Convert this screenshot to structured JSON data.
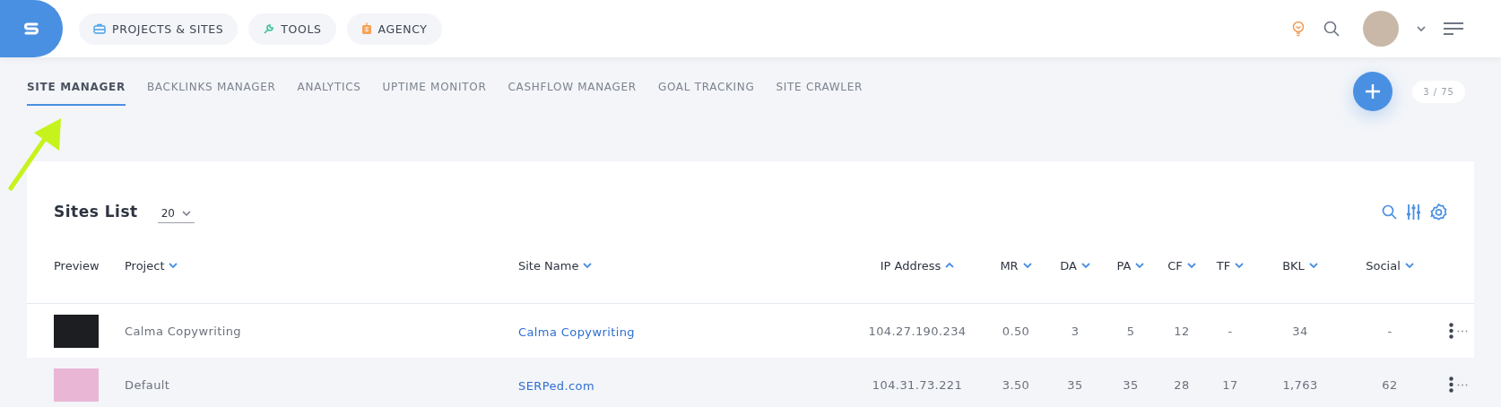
{
  "nav_buttons": [
    {
      "label": "PROJECTS & SITES",
      "kind": "briefcase"
    },
    {
      "label": "TOOLS",
      "kind": "wrench"
    },
    {
      "label": "AGENCY",
      "kind": "building"
    }
  ],
  "tabs": [
    {
      "label": "SITE MANAGER",
      "selected": true
    },
    {
      "label": "BACKLINKS MANAGER",
      "selected": false
    },
    {
      "label": "ANALYTICS",
      "selected": false
    },
    {
      "label": "UPTIME MONITOR",
      "selected": false
    },
    {
      "label": "CASHFLOW MANAGER",
      "selected": false
    },
    {
      "label": "GOAL TRACKING",
      "selected": false
    },
    {
      "label": "SITE CRAWLER",
      "selected": false
    }
  ],
  "counter": "3 / 75",
  "sites_list": {
    "title": "Sites List",
    "page_size": "20",
    "columns": [
      {
        "label": "Preview"
      },
      {
        "label": "Project",
        "sort_ascending": false
      },
      {
        "label": "Site Name",
        "sort_ascending": false
      },
      {
        "label": "IP Address",
        "sort_ascending": true
      },
      {
        "label": "MR",
        "sort_ascending": false
      },
      {
        "label": "DA",
        "sort_ascending": false
      },
      {
        "label": "PA",
        "sort_ascending": false
      },
      {
        "label": "CF",
        "sort_ascending": false
      },
      {
        "label": "TF",
        "sort_ascending": false
      },
      {
        "label": "BKL",
        "sort_ascending": false
      },
      {
        "label": "Social",
        "sort_ascending": false
      }
    ],
    "rows": [
      {
        "dark_preview": true,
        "project": "Calma Copywriting",
        "site_name": "Calma Copywriting",
        "ip_address": "104.27.190.234",
        "mr": "0.50",
        "da": "3",
        "pa": "5",
        "cf": "12",
        "tf": "-",
        "bkl": "34",
        "social": "-"
      },
      {
        "dark_preview": false,
        "project": "Default",
        "site_name": "SERPed.com",
        "ip_address": "104.31.73.221",
        "mr": "3.50",
        "da": "35",
        "pa": "35",
        "cf": "28",
        "tf": "17",
        "bkl": "1,763",
        "social": "62"
      }
    ]
  }
}
